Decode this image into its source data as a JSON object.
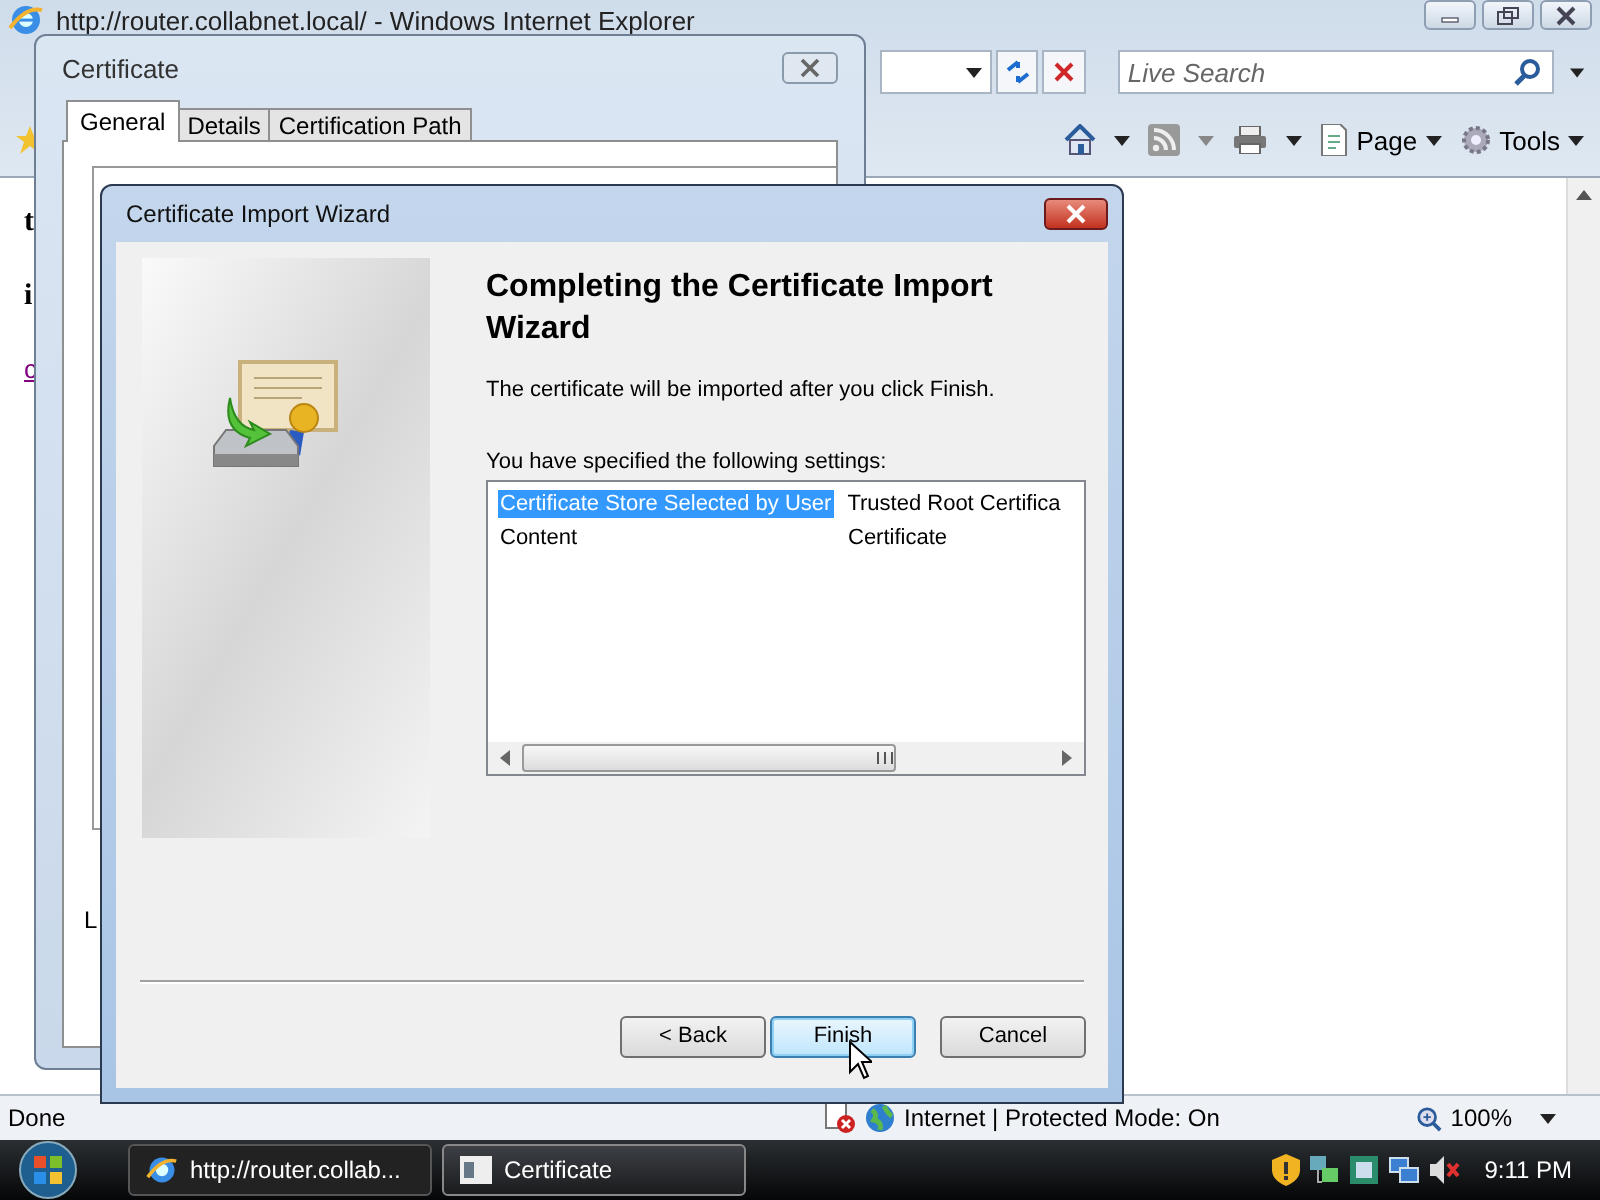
{
  "browser": {
    "title": "http://router.collabnet.local/ - Windows Internet Explorer",
    "search": {
      "placeholder": "Live Search"
    },
    "commands": [
      {
        "label": "Page"
      },
      {
        "label": "Tools"
      }
    ],
    "page_text": [
      {
        "text": "t",
        "kind": "heading"
      },
      {
        "text": "i",
        "kind": "heading"
      },
      {
        "text": "c",
        "kind": "link"
      }
    ],
    "status_bar": {
      "text": "Done",
      "zone": "Internet | Protected Mode: On",
      "zoom": "100%"
    }
  },
  "certificate_dialog": {
    "title": "Certificate",
    "tabs": [
      {
        "label": "General",
        "selected": true
      },
      {
        "label": "Details",
        "selected": false
      },
      {
        "label": "Certification Path",
        "selected": false
      }
    ],
    "fragment": "L"
  },
  "wizard": {
    "title": "Certificate Import Wizard",
    "heading": "Completing the Certificate Import Wizard",
    "message": "The certificate will be imported after you click Finish.",
    "list_label": "You have specified the following settings:",
    "settings": [
      {
        "name": "Certificate Store Selected by User",
        "value": "Trusted Root Certifica",
        "selected": true
      },
      {
        "name": "Content",
        "value": "Certificate",
        "selected": false
      }
    ],
    "buttons": [
      {
        "label": "< Back",
        "focused": false
      },
      {
        "label": "Finish",
        "focused": true
      },
      {
        "label": "Cancel",
        "focused": false
      }
    ]
  },
  "taskbar": {
    "tasks": [
      {
        "label": "http://router.collab...",
        "selected": false
      },
      {
        "label": "Certificate",
        "selected": true
      }
    ],
    "clock": "9:11 PM"
  }
}
